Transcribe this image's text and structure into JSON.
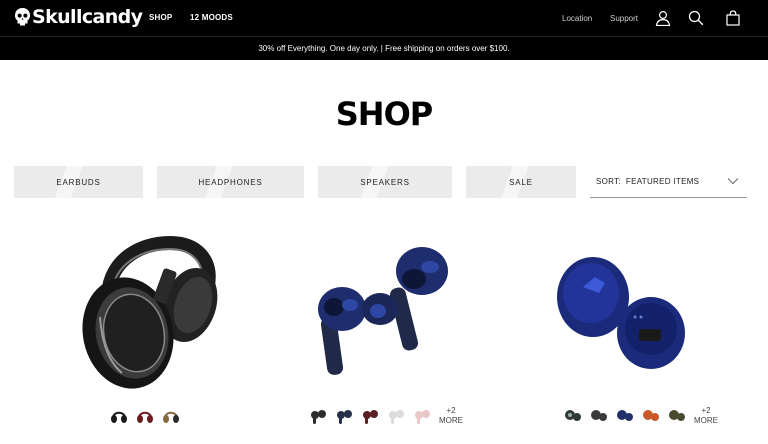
{
  "header": {
    "logo_text": "Skullcandy",
    "nav": [
      "SHOP",
      "12 MOODS"
    ],
    "right_links": [
      "Location",
      "Support"
    ],
    "icons": [
      "user-icon",
      "search-icon",
      "bag-icon"
    ]
  },
  "promo": {
    "text": "30% off Everything. One day only. | Free shipping on orders over $100."
  },
  "page": {
    "title": "SHOP"
  },
  "filters": {
    "tabs": [
      "EARBUDS",
      "HEADPHONES",
      "SPEAKERS",
      "SALE"
    ],
    "sort_label": "SORT:",
    "sort_value": "FEATURED ITEMS"
  },
  "products": [
    {
      "image": "over-ear-headphones",
      "swatches": [
        "#1a1a1a",
        "#6b1a1e",
        "#8a6a3a"
      ],
      "more": ""
    },
    {
      "image": "true-wireless-earbuds",
      "swatches": [
        "#2d2d2d",
        "#27324a",
        "#5a2023",
        "#dcdcdc",
        "#e8c8c8"
      ],
      "more": "+2\nMORE"
    },
    {
      "image": "true-wireless-earbuds-round",
      "swatches": [
        "#2f3a36",
        "#3a3a3a",
        "#22306a",
        "#c85a2a",
        "#4a4a30"
      ],
      "more": "+2\nMORE"
    }
  ],
  "colors": {
    "header_bg": "#000000",
    "tab_bg": "#ebebeb",
    "accent_blue": "#1d2d6e"
  }
}
